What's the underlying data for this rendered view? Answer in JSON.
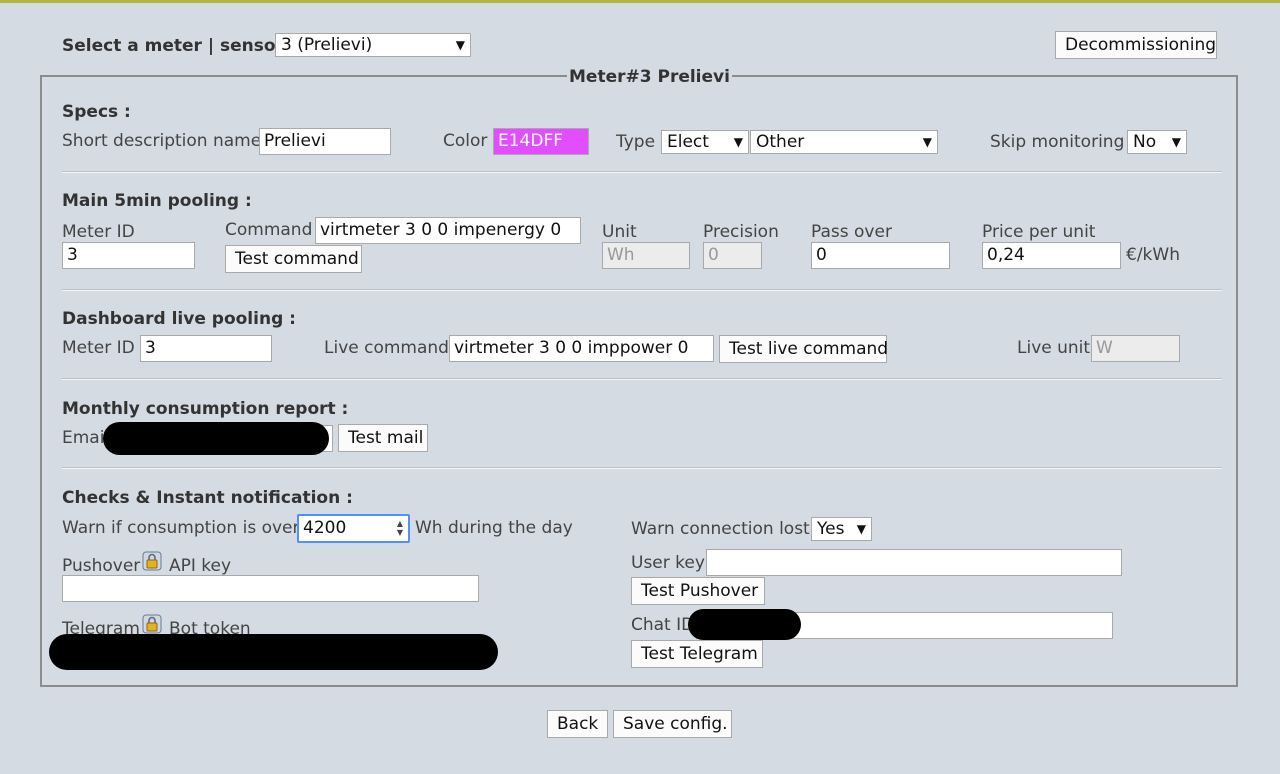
{
  "header": {
    "select_label": "Select a meter | sensor :",
    "meter_select_value": "3 (Prelievi)",
    "decommission_label": "Decommissioning"
  },
  "fieldset_title": "Meter#3 Prelievi",
  "specs": {
    "title": "Specs :",
    "short_desc_label": "Short description name",
    "short_desc_value": "Prelievi",
    "color_label": "Color",
    "color_value": "E14DFF",
    "color_hex": "#e14dff",
    "type_label": "Type",
    "type_value": "Elect",
    "subtype_value": "Other",
    "skip_label": "Skip monitoring",
    "skip_value": "No"
  },
  "pooling": {
    "title": "Main 5min pooling :",
    "meter_id_label": "Meter ID",
    "meter_id_value": "3",
    "command_label": "Command",
    "command_value": "virtmeter 3 0 0 impenergy 0",
    "test_command_label": "Test command",
    "unit_label": "Unit",
    "unit_value": "Wh",
    "precision_label": "Precision",
    "precision_value": "0",
    "pass_over_label": "Pass over",
    "pass_over_value": "0",
    "price_label": "Price per unit",
    "price_value": "0,24",
    "price_unit": "€/kWh"
  },
  "live": {
    "title": "Dashboard live pooling :",
    "meter_id_label": "Meter ID",
    "meter_id_value": "3",
    "live_command_label": "Live command",
    "live_command_value": "virtmeter 3 0 0 imppower 0",
    "test_live_label": "Test live command",
    "live_unit_label": "Live unit",
    "live_unit_value": "W"
  },
  "monthly": {
    "title": "Monthly consumption report :",
    "email_label": "Email",
    "test_mail_label": "Test mail"
  },
  "checks": {
    "title": "Checks & Instant notification :",
    "warn_label": "Warn if consumption is over",
    "warn_value": "4200",
    "warn_suffix": "Wh during the day",
    "warn_lost_label": "Warn connection lost",
    "warn_lost_value": "Yes",
    "pushover_label": "Pushover",
    "api_key_label": "API key",
    "user_key_label": "User key",
    "test_pushover_label": "Test Pushover",
    "telegram_label": "Telegram",
    "bot_token_label": "Bot token",
    "chat_id_label": "Chat ID",
    "test_telegram_label": "Test Telegram"
  },
  "footer": {
    "back_label": "Back",
    "save_label": "Save config."
  }
}
